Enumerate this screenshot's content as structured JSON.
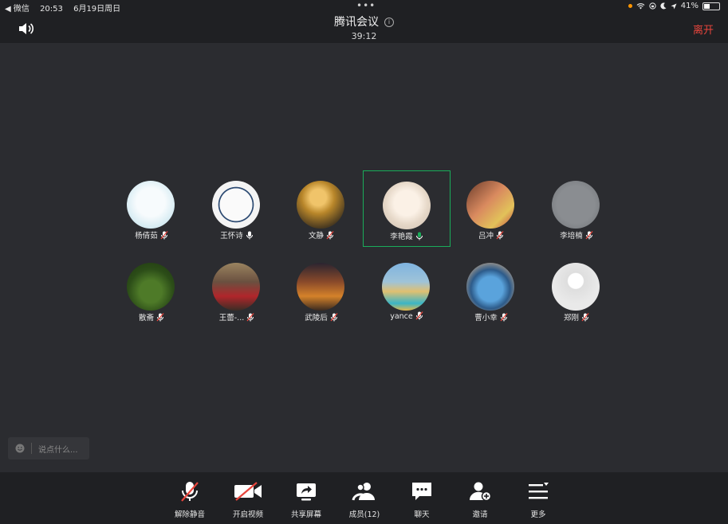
{
  "status_bar": {
    "back_app": "◀ 微信",
    "time": "20:53",
    "date": "6月19日周日",
    "battery": "41%"
  },
  "header": {
    "title": "腾讯会议",
    "timer": "39:12",
    "leave_label": "离开"
  },
  "participants": [
    {
      "name": "杨倩茹",
      "mic": "muted"
    },
    {
      "name": "王怀诗",
      "mic": "on"
    },
    {
      "name": "文静",
      "mic": "muted"
    },
    {
      "name": "李艳霞",
      "mic": "speaking",
      "active": true
    },
    {
      "name": "吕冲",
      "mic": "muted"
    },
    {
      "name": "李培楠",
      "mic": "muted"
    },
    {
      "name": "散斋",
      "mic": "muted"
    },
    {
      "name": "王蕾-...",
      "mic": "muted"
    },
    {
      "name": "武陵后",
      "mic": "muted"
    },
    {
      "name": "yance",
      "mic": "muted"
    },
    {
      "name": "曹小幸",
      "mic": "muted"
    },
    {
      "name": "郑刚",
      "mic": "muted"
    }
  ],
  "chat_input": {
    "placeholder": "说点什么..."
  },
  "toolbar": [
    {
      "label": "解除静音",
      "icon": "mic-muted-icon"
    },
    {
      "label": "开启视频",
      "icon": "video-off-icon"
    },
    {
      "label": "共享屏幕",
      "icon": "share-screen-icon"
    },
    {
      "label": "成员(12)",
      "icon": "members-icon"
    },
    {
      "label": "聊天",
      "icon": "chat-icon"
    },
    {
      "label": "邀请",
      "icon": "invite-icon"
    },
    {
      "label": "更多",
      "icon": "more-icon"
    }
  ],
  "colors": {
    "accent_green": "#1aad5a",
    "leave_red": "#e8453c",
    "background": "#2b2c30"
  }
}
